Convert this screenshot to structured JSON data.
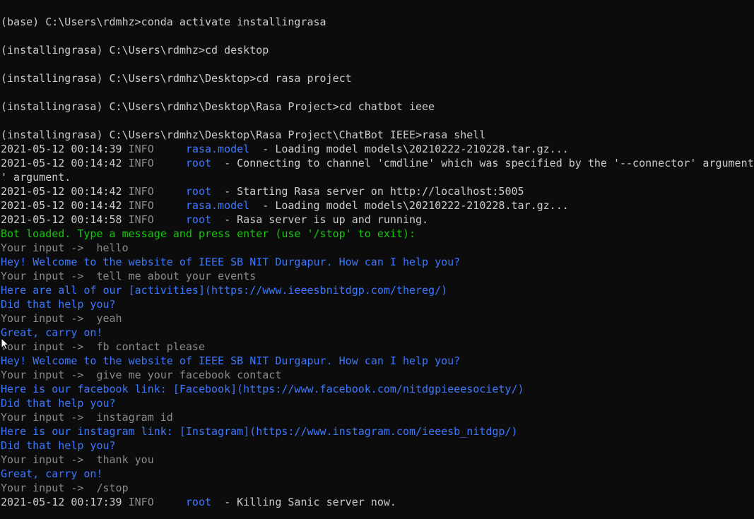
{
  "terminal": {
    "colors": {
      "background": "#0c0c0c",
      "default": "#cccccc",
      "log_level": "#8a8a8a",
      "logger": "#3b78ff",
      "bot_ready": "#16c60c",
      "user_input": "#8a8a8a",
      "bot_reply": "#3b78ff"
    },
    "lines": [
      {
        "type": "plain",
        "text": "(base) C:\\Users\\rdmhz>conda activate installingrasa"
      },
      {
        "type": "blank"
      },
      {
        "type": "plain",
        "text": "(installingrasa) C:\\Users\\rdmhz>cd desktop"
      },
      {
        "type": "blank"
      },
      {
        "type": "plain",
        "text": "(installingrasa) C:\\Users\\rdmhz\\Desktop>cd rasa project"
      },
      {
        "type": "blank"
      },
      {
        "type": "plain",
        "text": "(installingrasa) C:\\Users\\rdmhz\\Desktop\\Rasa Project>cd chatbot ieee"
      },
      {
        "type": "blank"
      },
      {
        "type": "plain",
        "text": "(installingrasa) C:\\Users\\rdmhz\\Desktop\\Rasa Project\\ChatBot IEEE>rasa shell"
      },
      {
        "type": "log",
        "timestamp": "2021-05-12 00:14:39",
        "level": "INFO",
        "logger": "rasa.model",
        "message": "  - Loading model models\\20210222-210228.tar.gz..."
      },
      {
        "type": "log",
        "timestamp": "2021-05-12 00:14:42",
        "level": "INFO",
        "logger": "root",
        "message": "  - Connecting to channel 'cmdline' which was specified by the '--connector' argument."
      },
      {
        "type": "plain",
        "text": "' argument."
      },
      {
        "type": "log",
        "timestamp": "2021-05-12 00:14:42",
        "level": "INFO",
        "logger": "root",
        "message": "  - Starting Rasa server on http://localhost:5005"
      },
      {
        "type": "log",
        "timestamp": "2021-05-12 00:14:42",
        "level": "INFO",
        "logger": "rasa.model",
        "message": "  - Loading model models\\20210222-210228.tar.gz..."
      },
      {
        "type": "log",
        "timestamp": "2021-05-12 00:14:58",
        "level": "INFO",
        "logger": "root",
        "message": "  - Rasa server is up and running."
      },
      {
        "type": "ready",
        "text": "Bot loaded. Type a message and press enter (use '/stop' to exit):"
      },
      {
        "type": "input",
        "text": "Your input ->  hello"
      },
      {
        "type": "reply",
        "text": "Hey! Welcome to the website of IEEE SB NIT Durgapur. How can I help you?"
      },
      {
        "type": "input",
        "text": "Your input ->  tell me about your events"
      },
      {
        "type": "reply",
        "text": "Here are all of our [activities](https://www.ieeesbnitdgp.com/thereg/)"
      },
      {
        "type": "reply",
        "text": "Did that help you?"
      },
      {
        "type": "input",
        "text": "Your input ->  yeah"
      },
      {
        "type": "reply",
        "text": "Great, carry on!"
      },
      {
        "type": "input",
        "text": "Your input ->  fb contact please"
      },
      {
        "type": "reply",
        "text": "Hey! Welcome to the website of IEEE SB NIT Durgapur. How can I help you?"
      },
      {
        "type": "input",
        "text": "Your input ->  give me your facebook contact"
      },
      {
        "type": "reply",
        "text": "Here is our facebook link: [Facebook](https://www.facebook.com/nitdgpieeesociety/)"
      },
      {
        "type": "reply",
        "text": "Did that help you?"
      },
      {
        "type": "input",
        "text": "Your input ->  instagram id"
      },
      {
        "type": "reply",
        "text": "Here is our instagram link: [Instagram](https://www.instagram.com/ieeesb_nitdgp/)"
      },
      {
        "type": "reply",
        "text": "Did that help you?"
      },
      {
        "type": "input",
        "text": "Your input ->  thank you"
      },
      {
        "type": "reply",
        "text": "Great, carry on!"
      },
      {
        "type": "input",
        "text": "Your input ->  /stop"
      },
      {
        "type": "log",
        "timestamp": "2021-05-12 00:17:39",
        "level": "INFO",
        "logger": "root",
        "message": "  - Killing Sanic server now."
      }
    ]
  },
  "cursor": {
    "icon": "mouse-pointer-icon"
  }
}
